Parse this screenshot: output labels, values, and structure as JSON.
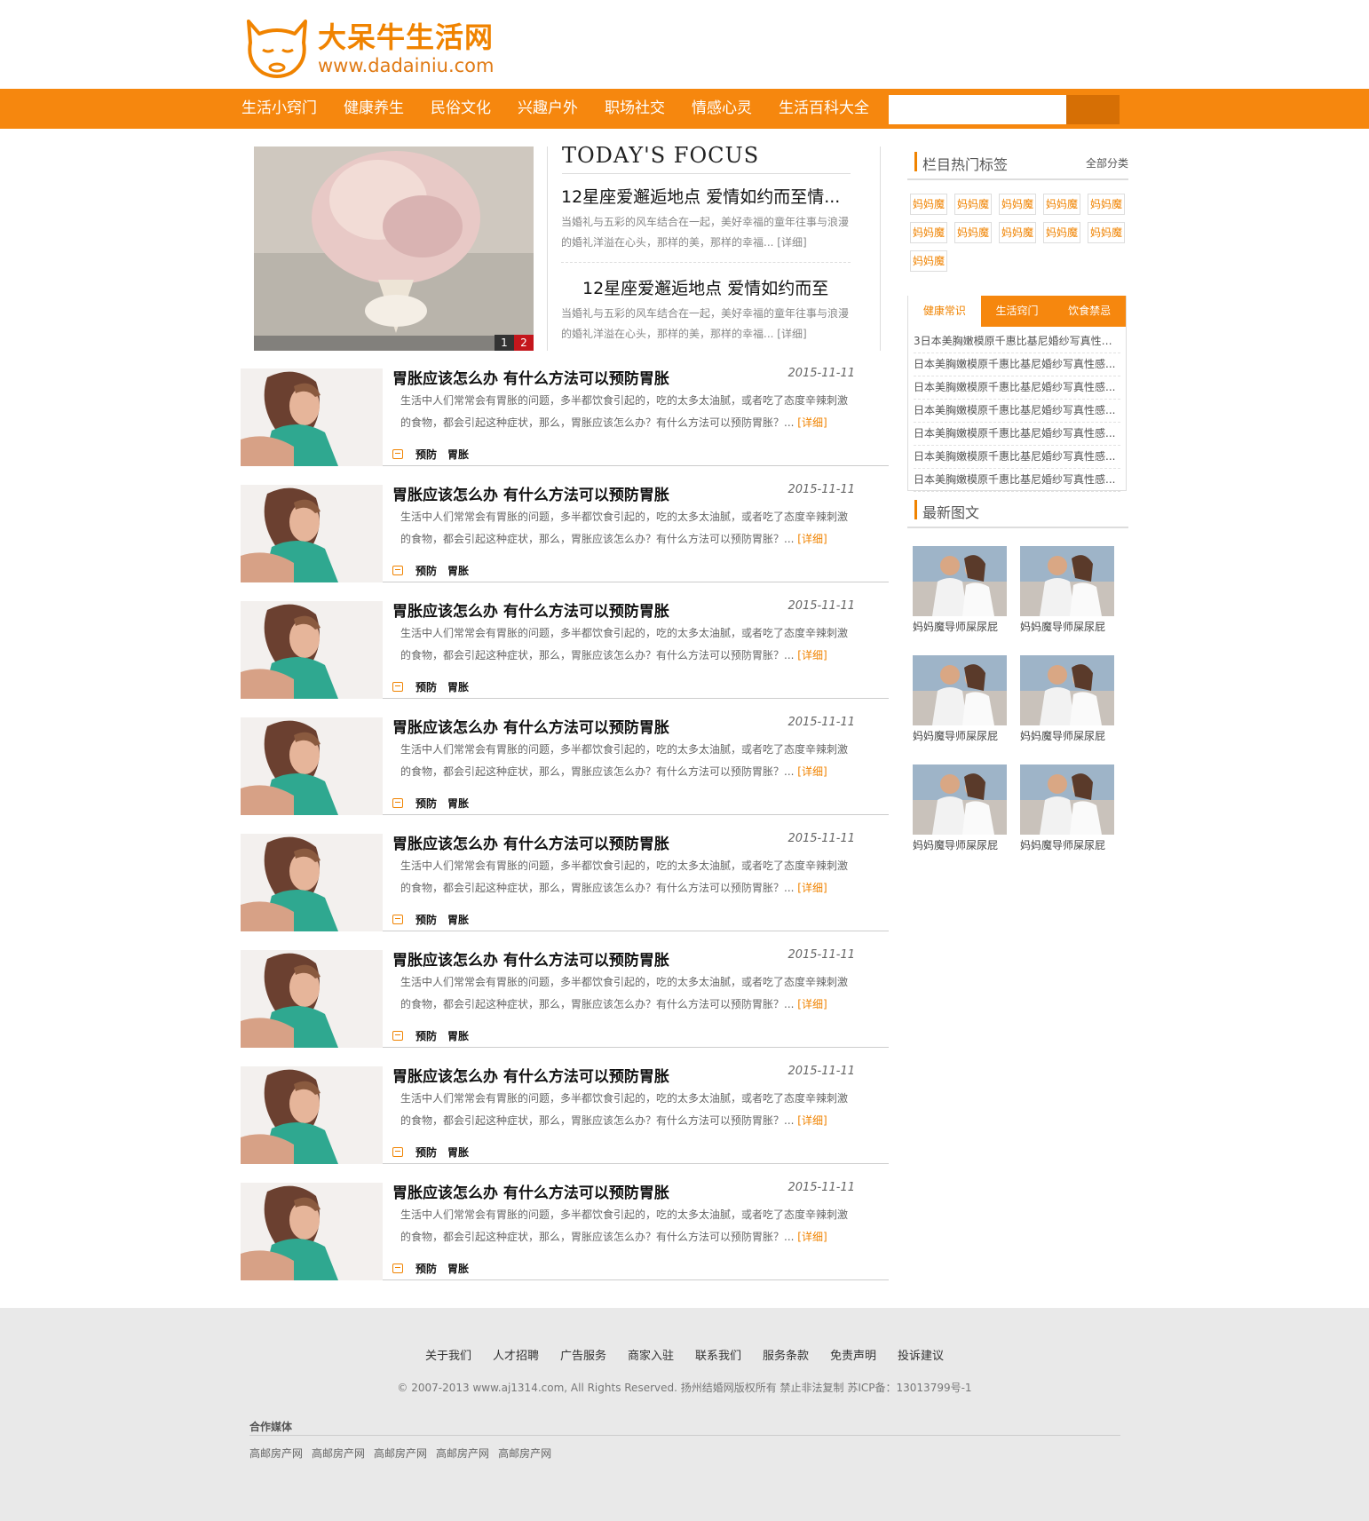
{
  "brand": {
    "title": "大呆牛生活网",
    "url": "www.dadainiu.com",
    "accent": "#f6870e"
  },
  "nav": {
    "items": [
      "生活小窍门",
      "健康养生",
      "民俗文化",
      "兴趣户外",
      "职场社交",
      "情感心灵",
      "生活百科大全"
    ]
  },
  "search": {
    "placeholder": "",
    "button_label": ""
  },
  "focus": {
    "heading": "TODAY'S FOCUS",
    "slider": [
      "1",
      "2"
    ],
    "items": [
      {
        "title": "12星座爱邂逅地点 爱情如约而至情...",
        "desc": "当婚礼与五彩的风车结合在一起，美好幸福的童年往事与浪漫的婚礼洋溢在心头，那样的美，那样的幸福...",
        "more": "[详细]"
      },
      {
        "title": "12星座爱邂逅地点 爱情如约而至",
        "desc": "当婚礼与五彩的风车结合在一起，美好幸福的童年往事与浪漫的婚礼洋溢在心头，那样的美，那样的幸福...",
        "more": "[详细]"
      }
    ]
  },
  "articles": [
    {
      "title": "胃胀应该怎么办 有什么方法可以预防胃胀",
      "date": "2015-11-11",
      "desc": "生活中人们常常会有胃胀的问题，多半都饮食引起的，吃的太多太油腻，或者吃了态度辛辣刺激的食物，都会引起这种症状，那么，胃胀应该怎么办？有什么方法可以预防胃胀？...",
      "more": "[详细]",
      "tags": [
        "预防",
        "胃胀"
      ]
    },
    {
      "title": "胃胀应该怎么办 有什么方法可以预防胃胀",
      "date": "2015-11-11",
      "desc": "生活中人们常常会有胃胀的问题，多半都饮食引起的，吃的太多太油腻，或者吃了态度辛辣刺激的食物，都会引起这种症状，那么，胃胀应该怎么办？有什么方法可以预防胃胀？...",
      "more": "[详细]",
      "tags": [
        "预防",
        "胃胀"
      ]
    },
    {
      "title": "胃胀应该怎么办 有什么方法可以预防胃胀",
      "date": "2015-11-11",
      "desc": "生活中人们常常会有胃胀的问题，多半都饮食引起的，吃的太多太油腻，或者吃了态度辛辣刺激的食物，都会引起这种症状，那么，胃胀应该怎么办？有什么方法可以预防胃胀？...",
      "more": "[详细]",
      "tags": [
        "预防",
        "胃胀"
      ]
    },
    {
      "title": "胃胀应该怎么办 有什么方法可以预防胃胀",
      "date": "2015-11-11",
      "desc": "生活中人们常常会有胃胀的问题，多半都饮食引起的，吃的太多太油腻，或者吃了态度辛辣刺激的食物，都会引起这种症状，那么，胃胀应该怎么办？有什么方法可以预防胃胀？...",
      "more": "[详细]",
      "tags": [
        "预防",
        "胃胀"
      ]
    },
    {
      "title": "胃胀应该怎么办 有什么方法可以预防胃胀",
      "date": "2015-11-11",
      "desc": "生活中人们常常会有胃胀的问题，多半都饮食引起的，吃的太多太油腻，或者吃了态度辛辣刺激的食物，都会引起这种症状，那么，胃胀应该怎么办？有什么方法可以预防胃胀？...",
      "more": "[详细]",
      "tags": [
        "预防",
        "胃胀"
      ]
    },
    {
      "title": "胃胀应该怎么办 有什么方法可以预防胃胀",
      "date": "2015-11-11",
      "desc": "生活中人们常常会有胃胀的问题，多半都饮食引起的，吃的太多太油腻，或者吃了态度辛辣刺激的食物，都会引起这种症状，那么，胃胀应该怎么办？有什么方法可以预防胃胀？...",
      "more": "[详细]",
      "tags": [
        "预防",
        "胃胀"
      ]
    },
    {
      "title": "胃胀应该怎么办 有什么方法可以预防胃胀",
      "date": "2015-11-11",
      "desc": "生活中人们常常会有胃胀的问题，多半都饮食引起的，吃的太多太油腻，或者吃了态度辛辣刺激的食物，都会引起这种症状，那么，胃胀应该怎么办？有什么方法可以预防胃胀？...",
      "more": "[详细]",
      "tags": [
        "预防",
        "胃胀"
      ]
    },
    {
      "title": "胃胀应该怎么办 有什么方法可以预防胃胀",
      "date": "2015-11-11",
      "desc": "生活中人们常常会有胃胀的问题，多半都饮食引起的，吃的太多太油腻，或者吃了态度辛辣刺激的食物，都会引起这种症状，那么，胃胀应该怎么办？有什么方法可以预防胃胀？...",
      "more": "[详细]",
      "tags": [
        "预防",
        "胃胀"
      ]
    }
  ],
  "sidebar": {
    "hot_tags": {
      "title": "栏目热门标签",
      "link": "全部分类",
      "tags": [
        "妈妈魔",
        "妈妈魔",
        "妈妈魔",
        "妈妈魔",
        "妈妈魔",
        "妈妈魔",
        "妈妈魔",
        "妈妈魔",
        "妈妈魔",
        "妈妈魔",
        "妈妈魔"
      ]
    },
    "tabs": {
      "labels": [
        "健康常识",
        "生活窍门",
        "饮食禁忌"
      ],
      "active": 0,
      "items": [
        "3日本美胸嫩模原千惠比基尼婚纱写真性感...",
        "日本美胸嫩模原千惠比基尼婚纱写真性感...",
        "日本美胸嫩模原千惠比基尼婚纱写真性感...",
        "日本美胸嫩模原千惠比基尼婚纱写真性感...",
        "日本美胸嫩模原千惠比基尼婚纱写真性感...",
        "日本美胸嫩模原千惠比基尼婚纱写真性感...",
        "日本美胸嫩模原千惠比基尼婚纱写真性感..."
      ]
    },
    "latest": {
      "title": "最新图文",
      "items": [
        "妈妈魔导师屎尿屁",
        "妈妈魔导师屎尿屁",
        "妈妈魔导师屎尿屁",
        "妈妈魔导师屎尿屁",
        "妈妈魔导师屎尿屁",
        "妈妈魔导师屎尿屁"
      ]
    }
  },
  "footer": {
    "links": [
      "关于我们",
      "人才招聘",
      "广告服务",
      "商家入驻",
      "联系我们",
      "服务条款",
      "免责声明",
      "投诉建议"
    ],
    "copyright": "© 2007-2013 www.aj1314.com, All Rights Reserved. 扬州结婚网版权所有 禁止非法复制 苏ICP备：13013799号-1",
    "partners_title": "合作媒体",
    "partners": [
      "高邮房产网",
      "高邮房产网",
      "高邮房产网",
      "高邮房产网",
      "高邮房产网"
    ]
  }
}
